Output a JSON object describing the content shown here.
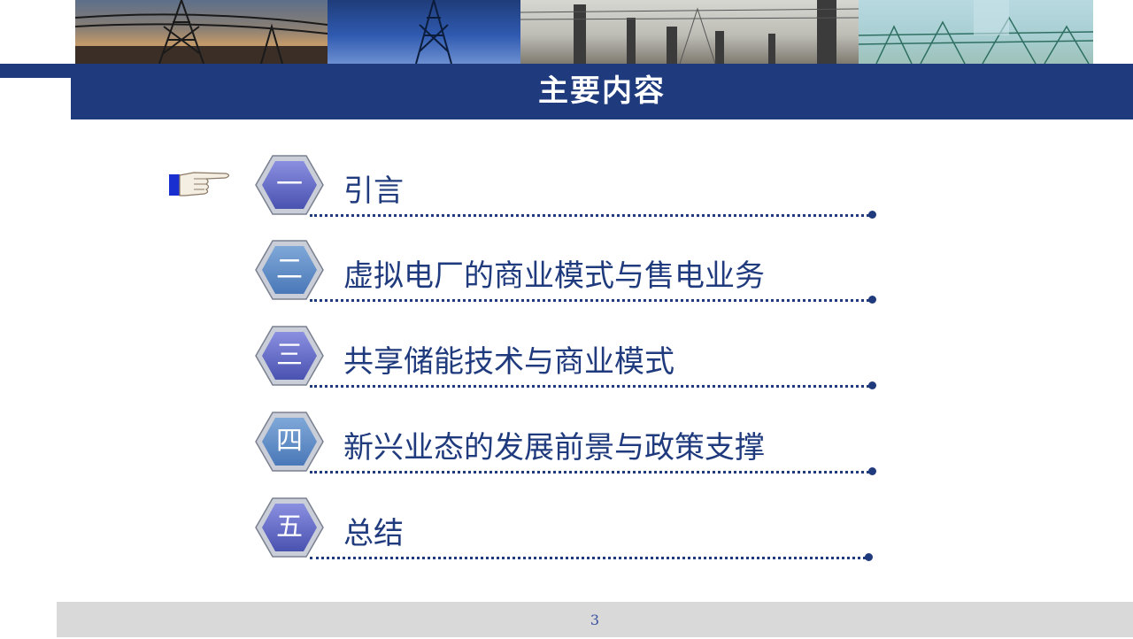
{
  "header": {
    "title": "主要内容"
  },
  "menu": {
    "items": [
      {
        "number": "一",
        "label": "引言"
      },
      {
        "number": "二",
        "label": "虚拟电厂的商业模式与售电业务"
      },
      {
        "number": "三",
        "label": "共享储能技术与商业模式"
      },
      {
        "number": "四",
        "label": "新兴业态的发展前景与政策支撑"
      },
      {
        "number": "五",
        "label": "总结"
      }
    ]
  },
  "footer": {
    "page_number": "3"
  },
  "colors": {
    "accent": "#1f3a7d",
    "footer_bg": "#d9d9d9",
    "hex_fill": "#6a72c8"
  },
  "icons": {
    "pointer": "pointing-hand-icon",
    "banner": "power-tower-photo"
  }
}
